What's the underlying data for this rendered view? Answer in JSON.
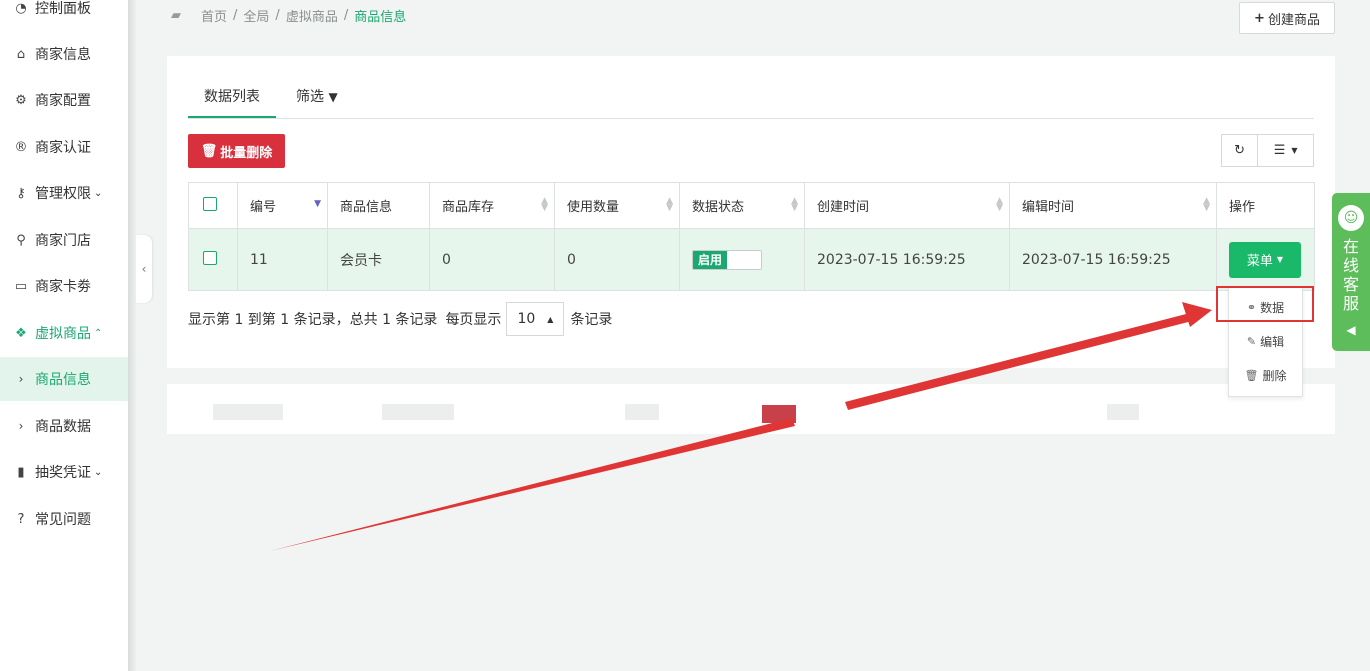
{
  "sidebar": {
    "items": [
      {
        "label": "控制面板",
        "icon": "dashboard-icon"
      },
      {
        "label": "商家信息",
        "icon": "home-icon"
      },
      {
        "label": "商家配置",
        "icon": "gears-icon"
      },
      {
        "label": "商家认证",
        "icon": "registered-icon"
      },
      {
        "label": "管理权限",
        "icon": "key-icon"
      },
      {
        "label": "商家门店",
        "icon": "map-marker-icon"
      },
      {
        "label": "商家卡劵",
        "icon": "credit-card-icon"
      },
      {
        "label": "虚拟商品",
        "icon": "dropbox-icon"
      },
      {
        "label": "商品信息",
        "icon": "chevron-right-icon"
      },
      {
        "label": "商品数据",
        "icon": "chevron-right-icon"
      },
      {
        "label": "抽奖凭证",
        "icon": "bookmark-icon"
      },
      {
        "label": "常见问题",
        "icon": "question-circle-icon"
      }
    ]
  },
  "breadcrumb": {
    "items": [
      "首页",
      "全局",
      "虚拟商品",
      "商品信息"
    ]
  },
  "header": {
    "create_label": "创建商品"
  },
  "tabs": [
    {
      "label": "数据列表",
      "active": true
    },
    {
      "label": "筛选",
      "active": false
    }
  ],
  "toolbar": {
    "batch_delete_label": "批量删除"
  },
  "table": {
    "columns": [
      "编号",
      "商品信息",
      "商品库存",
      "使用数量",
      "数据状态",
      "创建时间",
      "编辑时间",
      "操作"
    ],
    "rows": [
      {
        "id": "11",
        "info": "会员卡",
        "stock": "0",
        "used": "0",
        "status": "启用",
        "created": "2023-07-15 16:59:25",
        "edited": "2023-07-15 16:59:25",
        "action": "菜单"
      }
    ]
  },
  "pager": {
    "summary": "显示第 1 到第 1 条记录，总共 1 条记录",
    "per_page_prefix": "每页显示",
    "page_size": "10",
    "per_page_suffix": "条记录"
  },
  "dropdown": {
    "items": [
      {
        "label": "数据",
        "icon": "link-icon"
      },
      {
        "label": "编辑",
        "icon": "edit-icon"
      },
      {
        "label": "删除",
        "icon": "trash-icon"
      }
    ]
  },
  "service": {
    "label": "在线客服"
  },
  "colors": {
    "accent": "#1aa870",
    "danger": "#d8303d",
    "annotation": "#e03535",
    "service": "#5cbd5a"
  }
}
